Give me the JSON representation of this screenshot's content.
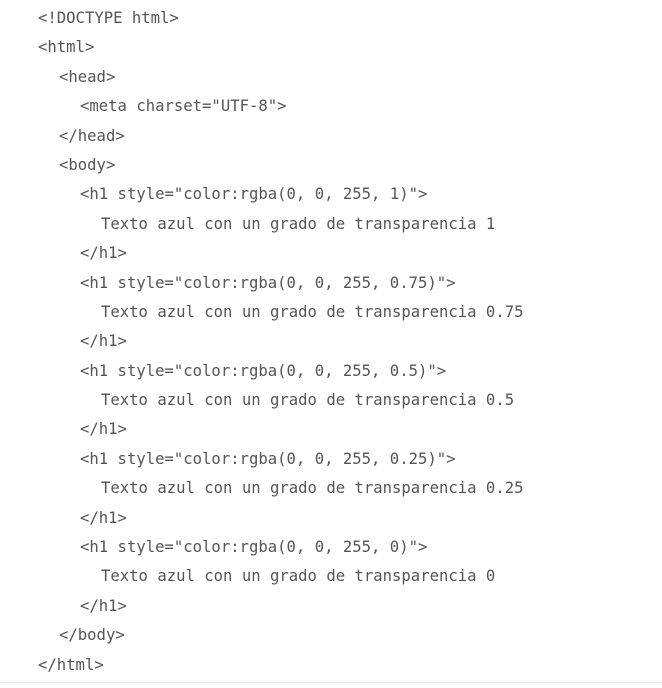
{
  "code": {
    "lines": [
      "<!DOCTYPE html>",
      "<html>",
      "<head>",
      "<meta charset=\"UTF-8\">",
      "</head>",
      "<body>",
      "<h1 style=\"color:rgba(0, 0, 255, 1)\">",
      "Texto azul con un grado de transparencia 1",
      "</h1>",
      "<h1 style=\"color:rgba(0, 0, 255, 0.75)\">",
      "Texto azul con un grado de transparencia 0.75",
      "</h1>",
      "<h1 style=\"color:rgba(0, 0, 255, 0.5)\">",
      "Texto azul con un grado de transparencia 0.5",
      "</h1>",
      "<h1 style=\"color:rgba(0, 0, 255, 0.25)\">",
      "Texto azul con un grado de transparencia 0.25",
      "</h1>",
      "<h1 style=\"color:rgba(0, 0, 255, 0)\">",
      "Texto azul con un grado de transparencia 0",
      "</h1>",
      "</body>",
      "</html>"
    ]
  },
  "colors": {
    "text": "#555555",
    "background": "#ffffff"
  }
}
